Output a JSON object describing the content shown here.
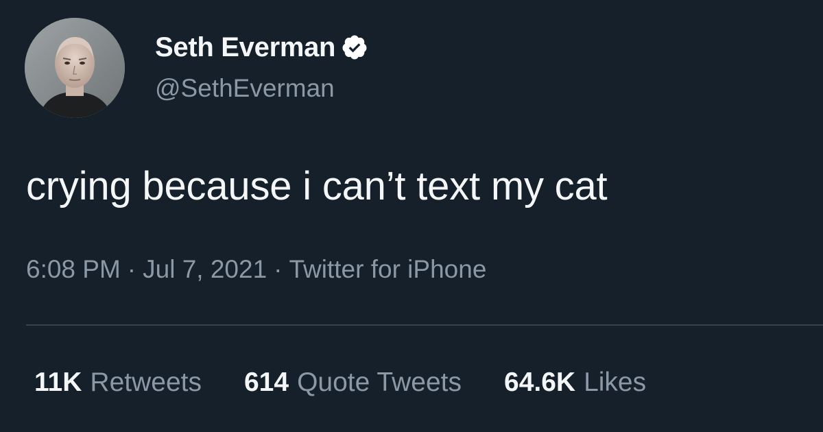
{
  "author": {
    "display_name": "Seth Everman",
    "handle": "@SethEverman",
    "verified": true,
    "avatar_icon": "profile-photo-avatar"
  },
  "tweet": {
    "text": "crying because i can’t text my cat",
    "time": "6:08 PM",
    "date": "Jul 7, 2021",
    "source": "Twitter for iPhone",
    "separator": "·"
  },
  "stats": {
    "retweets": {
      "count": "11K",
      "label": "Retweets"
    },
    "quote_tweets": {
      "count": "614",
      "label": "Quote Tweets"
    },
    "likes": {
      "count": "64.6K",
      "label": "Likes"
    }
  },
  "colors": {
    "background": "#15202b",
    "primary_text": "#f4f6f7",
    "secondary_text": "#8b98a5",
    "divider": "#38444d",
    "verified_badge": "#ffffff"
  }
}
